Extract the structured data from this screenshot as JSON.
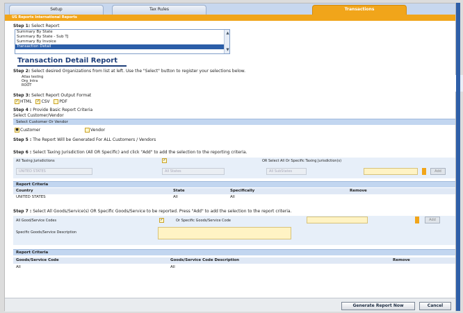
{
  "tabs": [
    "Setup",
    "Tax Rules",
    "Transactions"
  ],
  "breadcrumb": "US Reports  International Reports",
  "step1": {
    "label": "Step 1:",
    "text": "Select Report"
  },
  "report_list": [
    "Summary By State",
    "Summary By State - Sub TJ",
    "Summary By Invoice",
    "Transaction Detail"
  ],
  "report_title": "Transaction Detail Report",
  "step2": {
    "label": "Step 2:",
    "text": "Select desired Organizations from list at left. Use the \"Select\" button to register your selections below."
  },
  "org_list": [
    "Atlas testing",
    "Org_Intra",
    "ROOT"
  ],
  "step3": {
    "label": "Step 3:",
    "text": "Select Report Output Format"
  },
  "formats": [
    "HTML",
    "CSV",
    "PDF"
  ],
  "step4": {
    "label": "Step 4 :",
    "text": "Provide Basic Report Criteria"
  },
  "select_customer_vendor": "Select Customer/Vendor",
  "select_cv_bar": "Select Customer Or Vendor",
  "customer_label": "Customer",
  "vendor_label": "Vendor",
  "step5": {
    "label": "Step 5 :",
    "text": "The Report Will be Generated For ALL Customers / Vendors"
  },
  "step6": {
    "label": "Step 6 :",
    "text": "Select Taxing Jurisdiction (All OR Specific) and click \"Add\" to add the selection to the reporting criteria."
  },
  "all_tj_label": "All Taxing Jurisdictions",
  "or_specific_tj": "OR  Select All Or Specific Taxing Jurisdiction(s)",
  "country_select": "UNITED STATES",
  "state_select": "All States",
  "substate_select": "All SubStates",
  "add_label": "Add",
  "criteria1": {
    "title": "Report Criteria",
    "headers": [
      "Country",
      "State",
      "Specifically",
      "Remove"
    ],
    "row": [
      "UNITED STATES",
      "All",
      "All"
    ]
  },
  "step7": {
    "label": "Step 7 :",
    "text": "Select All Goods/Service(s) OR Specific Goods/Service to be reported. Press \"Add\" to add the selection to the report criteria."
  },
  "all_goods_label": "All Good/Service Codes",
  "or_specific_goods": "Or Specific Goods/Service Code",
  "goods_desc_label": "Specific Goods/Service Description",
  "criteria2": {
    "title": "Report Criteria",
    "headers": [
      "Goods/Service Code",
      "Goods/Service Code Description",
      "Remove"
    ],
    "row": [
      "All",
      "All"
    ]
  },
  "generate_button": "Generate Report Now",
  "cancel_button": "Cancel"
}
